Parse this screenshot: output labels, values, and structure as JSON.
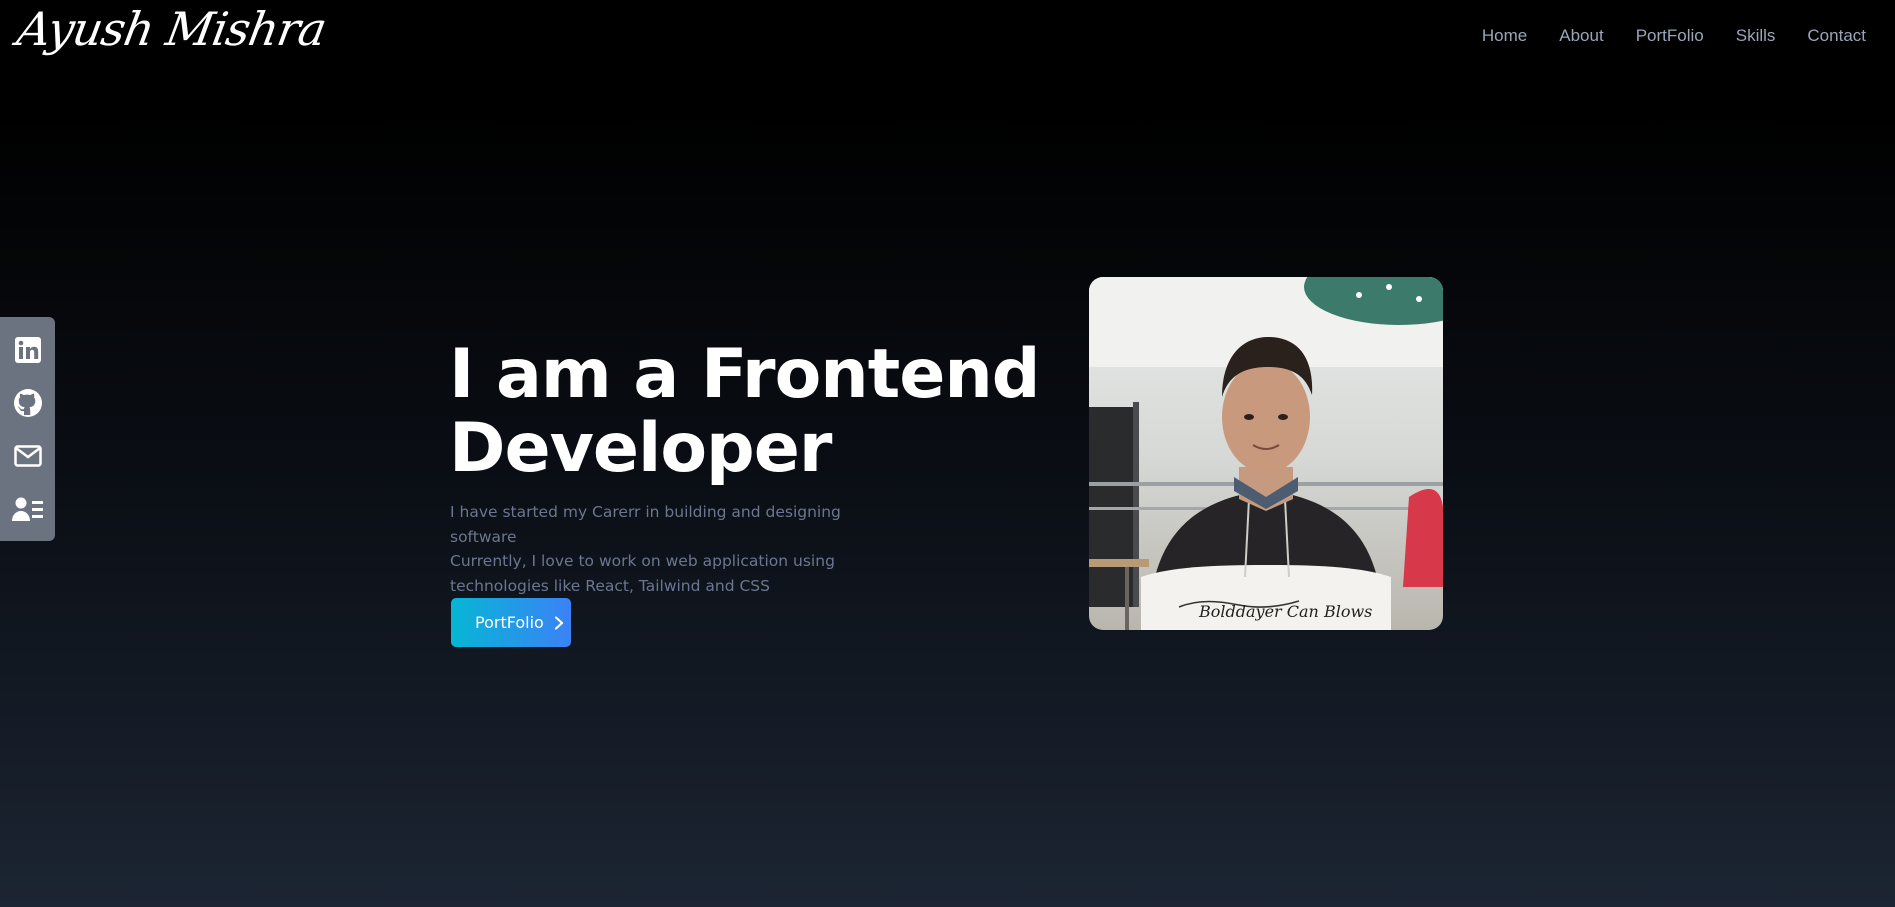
{
  "header": {
    "logo": "Ayush Mishra",
    "nav": [
      {
        "label": "Home"
      },
      {
        "label": "About"
      },
      {
        "label": "PortFolio"
      },
      {
        "label": "Skills"
      },
      {
        "label": "Contact"
      }
    ]
  },
  "social": {
    "items": [
      {
        "icon": "linkedin-icon"
      },
      {
        "icon": "github-icon"
      },
      {
        "icon": "mail-icon"
      },
      {
        "icon": "resume-icon"
      }
    ]
  },
  "hero": {
    "title_line1": "I am a Frontend",
    "title_line2": "Developer",
    "desc_line1": "I have started my Carerr in building and designing software",
    "desc_line2": "Currently, I love to work on web application using",
    "desc_line3": "technologies like React, Tailwind and CSS",
    "cta_label": "PortFolio",
    "photo_signature": "Bolddayer Can Blows"
  },
  "colors": {
    "accent_from": "#06b6d4",
    "accent_to": "#3b82f6",
    "nav_text": "#9aa5b8",
    "social_bar": "#6b7280"
  }
}
